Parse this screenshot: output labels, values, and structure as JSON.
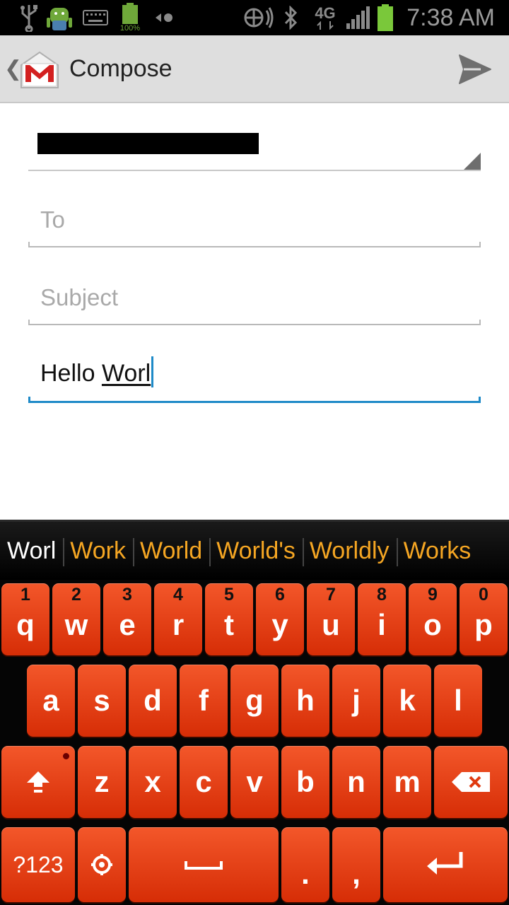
{
  "status_bar": {
    "icons": [
      "usb-icon",
      "android-icon",
      "keyboard-icon",
      "battery-full-icon",
      "data-sync-icon",
      "nfc-icon",
      "bluetooth-icon",
      "4g-lte-icon",
      "signal-icon",
      "battery-icon"
    ],
    "battery_small_label": "100%",
    "network_label": "4G",
    "time": "7:38 AM"
  },
  "action_bar": {
    "title": "Compose",
    "icons": [
      "up-chevron-icon",
      "gmail-icon",
      "send-icon"
    ]
  },
  "compose": {
    "to_placeholder": "To",
    "subject_placeholder": "Subject",
    "body_text_plain": "Hello ",
    "body_text_composing": "Worl"
  },
  "keyboard": {
    "suggestions": [
      "Worl",
      "Work",
      "World",
      "World's",
      "Worldly",
      "Works"
    ],
    "row1": [
      {
        "label": "q",
        "hint": "1"
      },
      {
        "label": "w",
        "hint": "2"
      },
      {
        "label": "e",
        "hint": "3"
      },
      {
        "label": "r",
        "hint": "4"
      },
      {
        "label": "t",
        "hint": "5"
      },
      {
        "label": "y",
        "hint": "6"
      },
      {
        "label": "u",
        "hint": "7"
      },
      {
        "label": "i",
        "hint": "8"
      },
      {
        "label": "o",
        "hint": "9"
      },
      {
        "label": "p",
        "hint": "0"
      }
    ],
    "row2": [
      "a",
      "s",
      "d",
      "f",
      "g",
      "h",
      "j",
      "k",
      "l"
    ],
    "row3": [
      "z",
      "x",
      "c",
      "v",
      "b",
      "n",
      "m"
    ],
    "symbols_label": "?123",
    "period": ".",
    "comma": ",",
    "colors": {
      "key": "#e8431a",
      "suggestion": "#f5a623",
      "accent": "#1e8ac8"
    }
  }
}
